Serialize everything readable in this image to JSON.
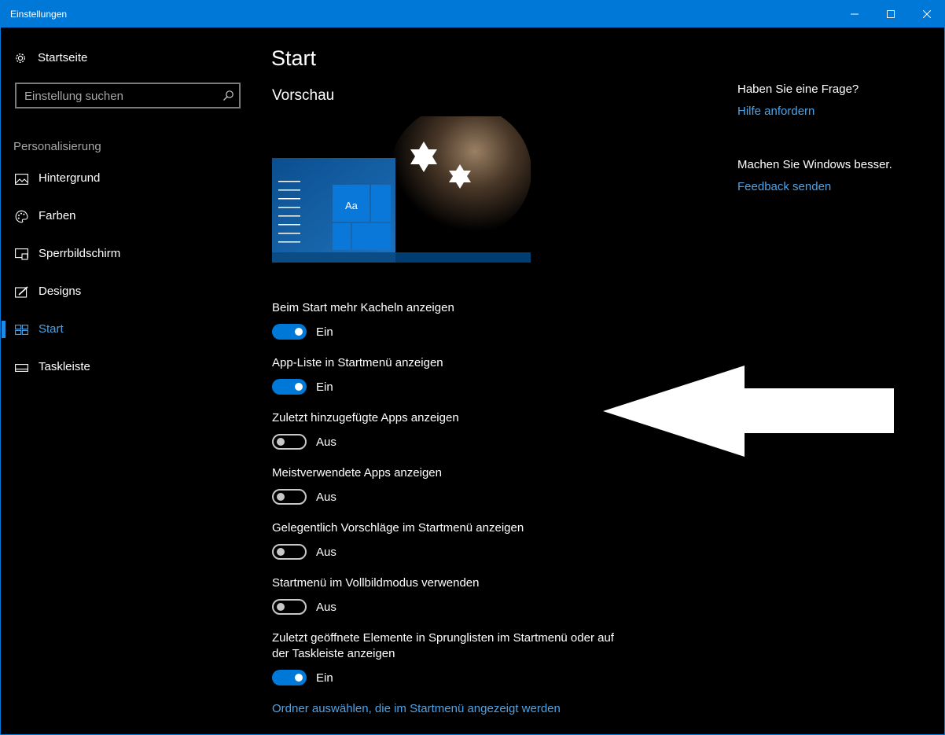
{
  "window": {
    "title": "Einstellungen"
  },
  "sidebar": {
    "home_label": "Startseite",
    "search_placeholder": "Einstellung suchen",
    "section_label": "Personalisierung",
    "items": [
      {
        "label": "Hintergrund",
        "icon": "image-icon",
        "active": false
      },
      {
        "label": "Farben",
        "icon": "palette-icon",
        "active": false
      },
      {
        "label": "Sperrbildschirm",
        "icon": "lock-screen-icon",
        "active": false
      },
      {
        "label": "Designs",
        "icon": "themes-icon",
        "active": false
      },
      {
        "label": "Start",
        "icon": "start-tiles-icon",
        "active": true
      },
      {
        "label": "Taskleiste",
        "icon": "taskbar-icon",
        "active": false
      }
    ]
  },
  "main": {
    "title": "Start",
    "preview_title": "Vorschau",
    "preview_tile_label": "Aa",
    "settings": [
      {
        "label": "Beim Start mehr Kacheln anzeigen",
        "on": true,
        "state": "Ein"
      },
      {
        "label": "App-Liste in Startmenü anzeigen",
        "on": true,
        "state": "Ein"
      },
      {
        "label": "Zuletzt hinzugefügte Apps anzeigen",
        "on": false,
        "state": "Aus"
      },
      {
        "label": "Meistverwendete Apps anzeigen",
        "on": false,
        "state": "Aus"
      },
      {
        "label": "Gelegentlich Vorschläge im Startmenü anzeigen",
        "on": false,
        "state": "Aus"
      },
      {
        "label": "Startmenü im Vollbildmodus verwenden",
        "on": false,
        "state": "Aus"
      },
      {
        "label": "Zuletzt geöffnete Elemente in Sprunglisten im Startmenü oder auf der Taskleiste anzeigen",
        "on": true,
        "state": "Ein"
      }
    ],
    "folders_link": "Ordner auswählen, die im Startmenü angezeigt werden"
  },
  "help": {
    "question": "Haben Sie eine Frage?",
    "help_link": "Hilfe anfordern",
    "improve": "Machen Sie Windows besser.",
    "feedback_link": "Feedback senden"
  },
  "colors": {
    "accent": "#0078d7",
    "link": "#4ea3e6",
    "background": "#000000"
  }
}
